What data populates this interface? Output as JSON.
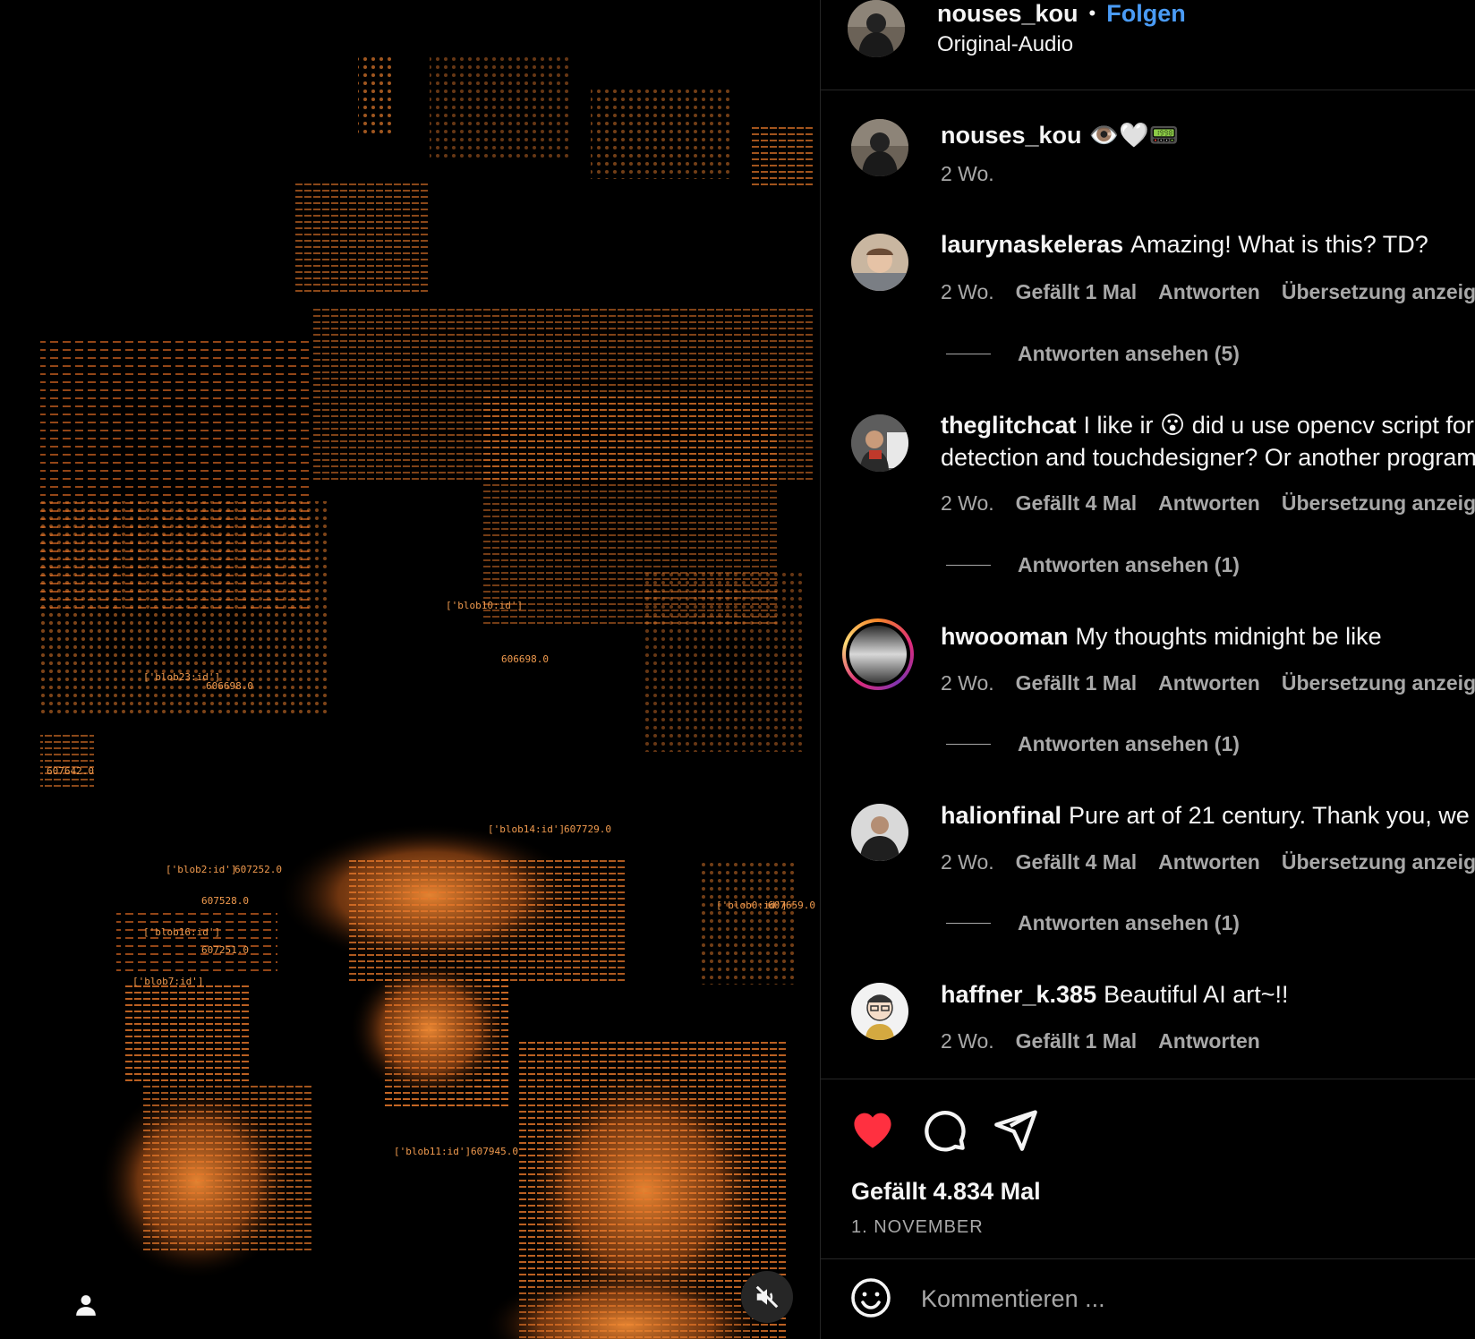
{
  "post": {
    "author": "nouses_kou",
    "follow_label": "Folgen",
    "separator": "•",
    "audio": "Original-Audio"
  },
  "caption": {
    "username": "nouses_kou",
    "text": "👁️🤍📟",
    "time": "2 Wo."
  },
  "comments": [
    {
      "username": "laurynaskeleras",
      "lines": [
        "Amazing! What is this? TD?"
      ],
      "time": "2 Wo.",
      "likes": "Gefällt 1 Mal",
      "reply": "Antworten",
      "translate": "Übersetzung anzeigen",
      "view_replies": "Antworten ansehen (5)"
    },
    {
      "username": "theglitchcat",
      "lines": [
        "I like ir 😮 did u use opencv script for",
        "detection and touchdesigner? Or another program?"
      ],
      "time": "2 Wo.",
      "likes": "Gefällt 4 Mal",
      "reply": "Antworten",
      "translate": "Übersetzung anzeigen",
      "view_replies": "Antworten ansehen (1)"
    },
    {
      "username": "hwoooman",
      "lines": [
        "My thoughts midnight be like"
      ],
      "time": "2 Wo.",
      "likes": "Gefällt 1 Mal",
      "reply": "Antworten",
      "translate": "Übersetzung anzeigen",
      "view_replies": "Antworten ansehen (1)"
    },
    {
      "username": "halionfinal",
      "lines": [
        "Pure art of 21 century. Thank you, we"
      ],
      "time": "2 Wo.",
      "likes": "Gefällt 4 Mal",
      "reply": "Antworten",
      "translate": "Übersetzung anzeigen",
      "view_replies": "Antworten ansehen (1)"
    },
    {
      "username": "haffner_k.385",
      "lines": [
        "Beautiful AI art~!!"
      ],
      "time": "2 Wo.",
      "likes": "Gefällt 1 Mal",
      "reply": "Antworten"
    }
  ],
  "stats": {
    "likes": "Gefällt 4.834 Mal",
    "date": "1. NOVEMBER"
  },
  "composer": {
    "placeholder": "Kommentieren ..."
  },
  "overlay_labels": [
    "['blob16:id']",
    "607528.0",
    "['blob7:id']",
    "607251.0",
    "['blob10:id']",
    "606698.0",
    "['blob23:id']",
    "606698.0",
    "['blob0:id']",
    "607659.0",
    "['blob11:id']",
    "607945.0",
    "['blob14:id']",
    "607729.0",
    "['blob2:id']",
    "607252.0",
    "607642.0"
  ],
  "colors": {
    "accent_blue": "#4a9bf5",
    "heart_red": "#ff3040",
    "art_orange": "#e07a2e",
    "secondary_text": "#a8a8a8"
  },
  "icons": {
    "like": "heart-filled-icon",
    "comment": "speech-bubble-icon",
    "share": "paper-plane-icon",
    "emoji": "smiley-icon",
    "mute": "speaker-muted-icon",
    "user_tags": "person-icon"
  }
}
